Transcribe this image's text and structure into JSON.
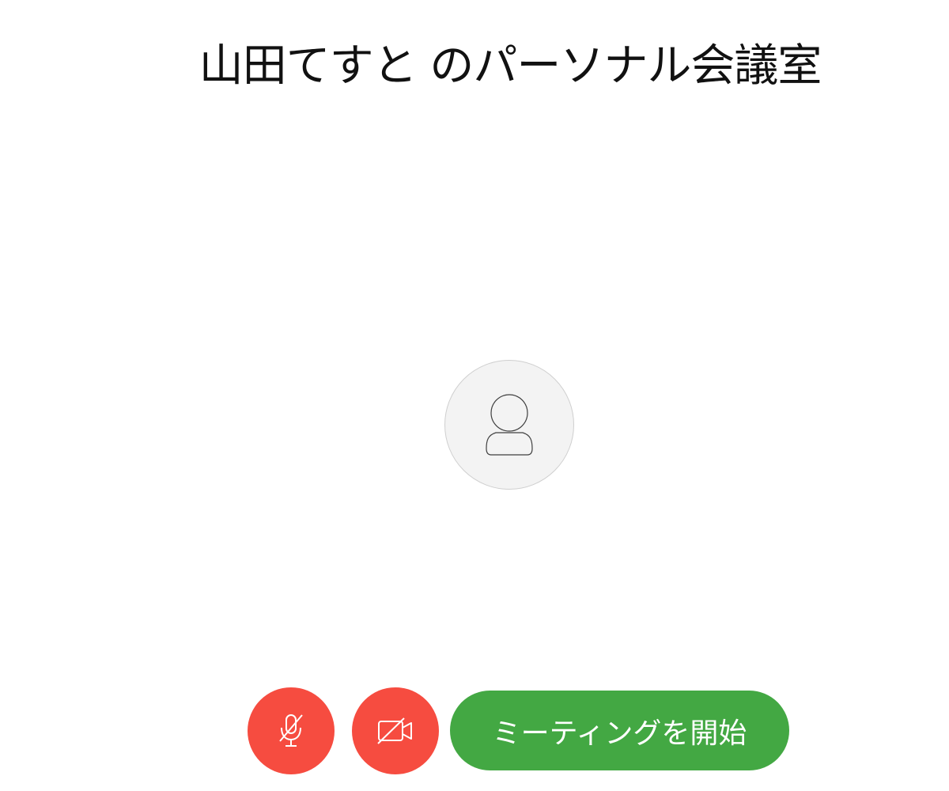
{
  "room": {
    "title": "山田てすと のパーソナル会議室"
  },
  "preview": {
    "avatar_icon": "user-silhouette-icon"
  },
  "controls": {
    "mic_icon": "microphone-muted-icon",
    "camera_icon": "camera-off-icon",
    "start_label": "ミーティングを開始",
    "mute_color": "#f64c40",
    "start_color": "#43a843"
  }
}
